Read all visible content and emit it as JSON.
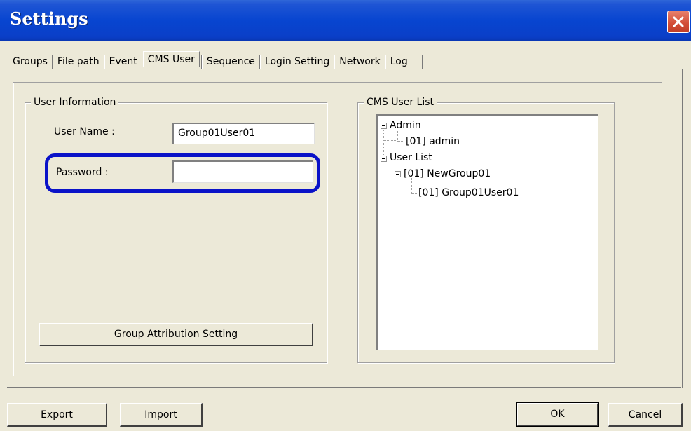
{
  "window": {
    "title": "Settings",
    "close_icon": "close-icon"
  },
  "tabs": [
    {
      "label": "Groups"
    },
    {
      "label": "File path"
    },
    {
      "label": "Event"
    },
    {
      "label": "CMS User",
      "active": true
    },
    {
      "label": "Sequence"
    },
    {
      "label": "Login Setting"
    },
    {
      "label": "Network"
    },
    {
      "label": "Log"
    }
  ],
  "user_info": {
    "legend": "User Information",
    "username_label": "User Name :",
    "username_value": "Group01User01",
    "password_label": "Password :",
    "password_value": "",
    "group_attribution_button": "Group Attribution Setting"
  },
  "cms_user_list": {
    "legend": "CMS User List",
    "tree": [
      {
        "label": "Admin"
      },
      {
        "label": "[01] admin"
      },
      {
        "label": "User List"
      },
      {
        "label": "[01] NewGroup01"
      },
      {
        "label": "[01] Group01User01"
      }
    ]
  },
  "footer": {
    "export_label": "Export",
    "import_label": "Import",
    "ok_label": "OK",
    "cancel_label": "Cancel"
  },
  "colors": {
    "titlebar": "#0845d0",
    "highlight": "#0a12c8",
    "dialog_bg": "#ece9d8"
  }
}
